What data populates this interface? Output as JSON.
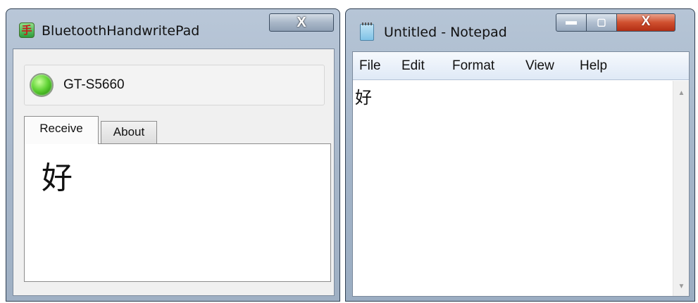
{
  "left_window": {
    "title": "BluetoothHandwritePad",
    "app_icon_glyph": "手",
    "close_glyph": "X",
    "device": {
      "name": "GT-S5660",
      "status_color": "#4cc521"
    },
    "tabs": [
      {
        "label": "Receive",
        "selected": true
      },
      {
        "label": "About",
        "selected": false
      }
    ],
    "received_text": "好"
  },
  "right_window": {
    "title": "Untitled - Notepad",
    "buttons": {
      "minimize_glyph": "▬",
      "maximize_glyph": "▢",
      "close_glyph": "X"
    },
    "menu": [
      "File",
      "Edit",
      "Format",
      "View",
      "Help"
    ],
    "editor_text": "好",
    "scrollbar": {
      "up_glyph": "▲",
      "down_glyph": "▼"
    }
  },
  "colors": {
    "close_button_red": "#c7401f",
    "window_frame": "#a6b6c9"
  }
}
